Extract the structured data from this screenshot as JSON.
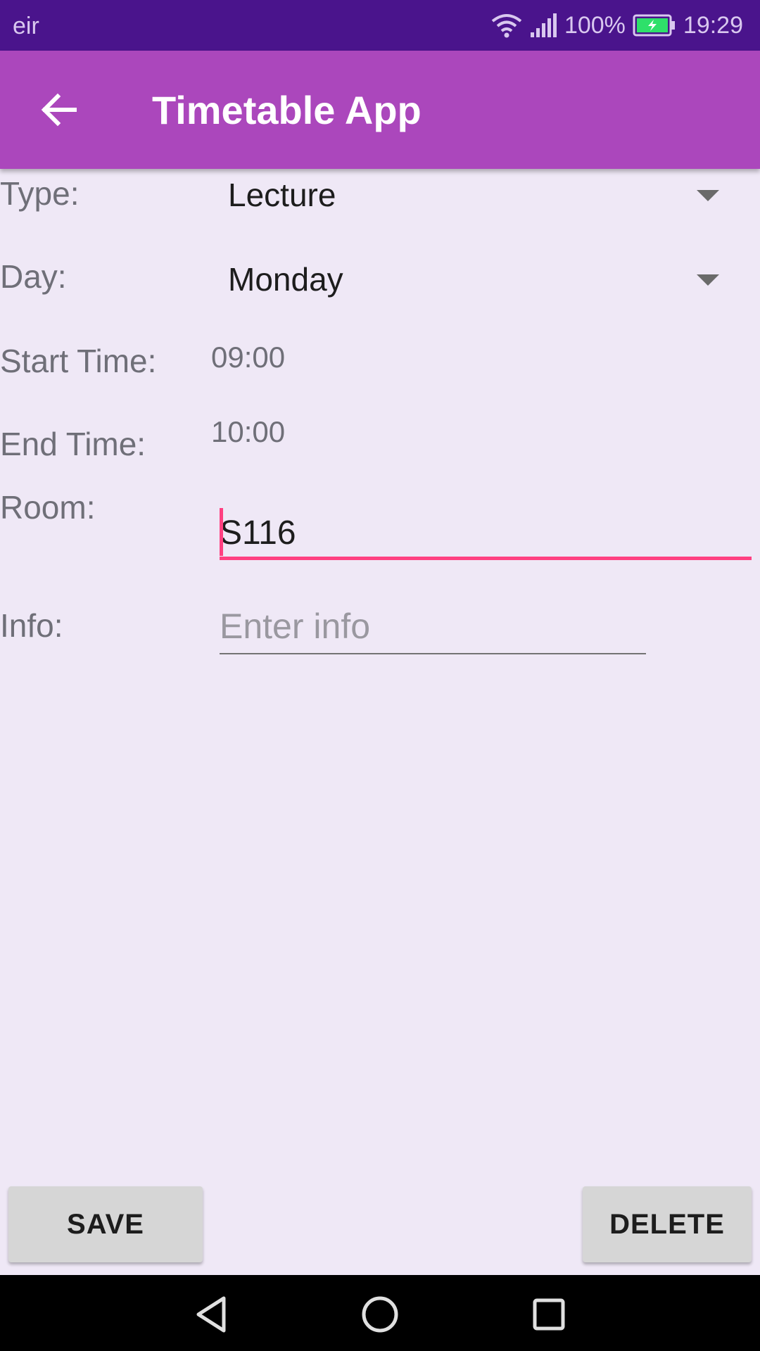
{
  "status_bar": {
    "carrier": "eir",
    "battery": "100%",
    "time": "19:29",
    "icons": [
      "wifi-icon",
      "signal-icon",
      "battery-charging-icon"
    ]
  },
  "app_bar": {
    "title": "Timetable App",
    "back_icon": "arrow-back-icon"
  },
  "form": {
    "type": {
      "label": "Type:",
      "value": "Lecture"
    },
    "day": {
      "label": "Day:",
      "value": "Monday"
    },
    "start_time": {
      "label": "Start Time:",
      "value": "09:00"
    },
    "end_time": {
      "label": "End Time:",
      "value": "10:00"
    },
    "room": {
      "label": "Room:",
      "value": "S116"
    },
    "info": {
      "label": "Info:",
      "value": "",
      "placeholder": "Enter info"
    }
  },
  "actions": {
    "save_label": "SAVE",
    "delete_label": "DELETE"
  },
  "nav_bar": {
    "icons": [
      "back-triangle-icon",
      "home-circle-icon",
      "recents-square-icon"
    ]
  },
  "colors": {
    "status_bar": "#4a148c",
    "app_bar": "#ab47bc",
    "background": "#efe8f6",
    "accent": "#ff4081",
    "button": "#d6d6d6"
  }
}
